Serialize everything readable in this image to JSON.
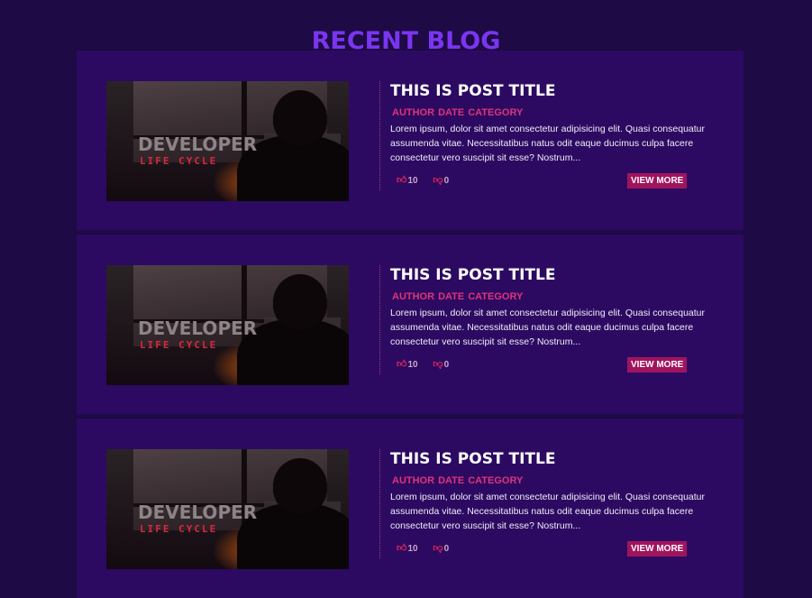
{
  "page": {
    "title": "RECENT BLOG"
  },
  "colors": {
    "background": "#1e0a44",
    "card": "#2c0a62",
    "heading": "#7a35f0",
    "accent": "#e0337a",
    "button": "#a0145e"
  },
  "posts": [
    {
      "thumbnail": {
        "line1": "DEVELOPER",
        "line2": "LIFE CYCLE"
      },
      "title": "THIS IS POST TITLE",
      "author": "AUTHOR",
      "date": "DATE",
      "category": "CATEGORY",
      "excerpt": "Lorem ipsum, dolor sit amet consectetur adipisicing elit. Quasi consequatur assumenda vitae. Necessitatibus natus odit eaque ducimus culpa facere consectetur vero suscipit sit esse? Nostrum...",
      "likes": "10",
      "dislikes": "0",
      "view_more": "VIEW MORE"
    },
    {
      "thumbnail": {
        "line1": "DEVELOPER",
        "line2": "LIFE CYCLE"
      },
      "title": "THIS IS POST TITLE",
      "author": "AUTHOR",
      "date": "DATE",
      "category": "CATEGORY",
      "excerpt": "Lorem ipsum, dolor sit amet consectetur adipisicing elit. Quasi consequatur assumenda vitae. Necessitatibus natus odit eaque ducimus culpa facere consectetur vero suscipit sit esse? Nostrum...",
      "likes": "10",
      "dislikes": "0",
      "view_more": "VIEW MORE"
    },
    {
      "thumbnail": {
        "line1": "DEVELOPER",
        "line2": "LIFE CYCLE"
      },
      "title": "THIS IS POST TITLE",
      "author": "AUTHOR",
      "date": "DATE",
      "category": "CATEGORY",
      "excerpt": "Lorem ipsum, dolor sit amet consectetur adipisicing elit. Quasi consequatur assumenda vitae. Necessitatibus natus odit eaque ducimus culpa facere consectetur vero suscipit sit esse? Nostrum...",
      "likes": "10",
      "dislikes": "0",
      "view_more": "VIEW MORE"
    }
  ],
  "icons": {
    "like": "thumbs-up-icon",
    "dislike": "thumbs-down-icon"
  }
}
